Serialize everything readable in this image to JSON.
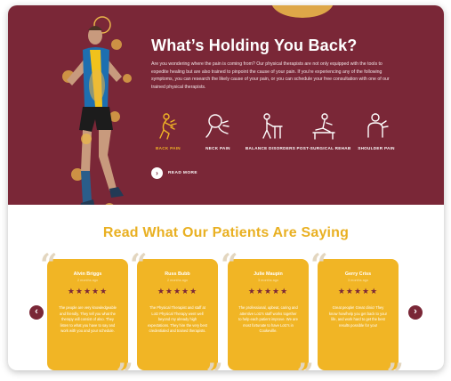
{
  "hero": {
    "title": "What’s Holding You Back?",
    "intro": "Are you wondering where the pain is coming from? Our physical therapists are not only equipped with the tools to expedite healing but are also trained to pinpoint the cause of your pain. If you're experiencing any of the following symptoms, you can research the likely cause of your pain, or you can schedule your free consultation with one of our trained physical therapists.",
    "symptoms": [
      {
        "label": "BACK PAIN",
        "icon": "back-pain-icon",
        "active": true
      },
      {
        "label": "NECK PAIN",
        "icon": "neck-pain-icon",
        "active": false
      },
      {
        "label": "BALANCE DISORDERS",
        "icon": "balance-icon",
        "active": false
      },
      {
        "label": "POST-SURGICAL REHAB",
        "icon": "rehab-icon",
        "active": false
      },
      {
        "label": "SHOULDER PAIN",
        "icon": "shoulder-icon",
        "active": false
      }
    ],
    "read_more": "READ MORE"
  },
  "testimonials": {
    "title": "Read What Our Patients Are Saying",
    "prev": "‹",
    "next": "›",
    "reviews": [
      {
        "name": "Alvin Briggs",
        "time": "2 months ago",
        "stars": "★★★★★",
        "rating": 5,
        "text": "The people are very knowledgeable and friendly. They tell you what the therapy will consist of also. They listen to what you have to say and work with you and your schedule."
      },
      {
        "name": "Russ Bubb",
        "time": "2 months ago",
        "stars": "★★★★★",
        "rating": 5,
        "text": "The Physical Therapist and staff at Lotz Physical Therapy went well beyond my already high expectations. They hire the very best credentialed and trained therapists."
      },
      {
        "name": "Julie Maupin",
        "time": "3 months ago",
        "stars": "★★★★★",
        "rating": 5,
        "text": "The professional, upbeat, caring and attentive Lotz's staff works together to help each patient improve. We are most fortunate to have Lotz's in Cookeville."
      },
      {
        "name": "Gerry Criss",
        "time": "3 months ago",
        "stars": "★★★★★",
        "rating": 5,
        "text": "Great people! Great clinic! They know how/help you get back to your life, and work hard to get the best results possible for you!"
      }
    ]
  },
  "colors": {
    "maroon": "#7a2737",
    "gold": "#f1b525",
    "white": "#ffffff"
  }
}
